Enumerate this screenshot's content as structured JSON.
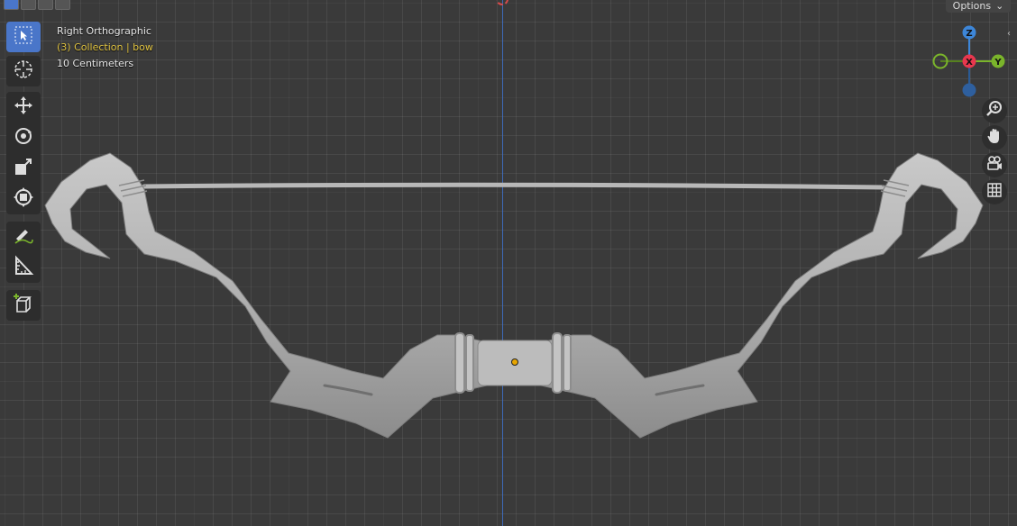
{
  "viewport": {
    "view_name": "Right Orthographic",
    "collection_label": "(3) Collection | bow",
    "scale_label": "10 Centimeters"
  },
  "header": {
    "options_label": "Options"
  },
  "toolbar": {
    "tools": [
      {
        "name": "select-box",
        "icon": "cursor-select-icon",
        "active": true
      },
      {
        "name": "cursor",
        "icon": "crosshair-cursor-icon"
      },
      {
        "name": "move",
        "icon": "move-arrows-icon"
      },
      {
        "name": "rotate",
        "icon": "rotate-icon"
      },
      {
        "name": "scale",
        "icon": "scale-icon"
      },
      {
        "name": "transform",
        "icon": "transform-icon"
      },
      {
        "name": "annotate",
        "icon": "annotate-pen-icon"
      },
      {
        "name": "measure",
        "icon": "measure-ruler-icon"
      },
      {
        "name": "add-cube",
        "icon": "add-cube-icon"
      }
    ]
  },
  "gizmo": {
    "x_label": "X",
    "y_label": "Y",
    "z_label": "Z",
    "x_color": "#e8374e",
    "y_color": "#7ab42b",
    "z_color": "#3d86d8"
  },
  "navigation": [
    "zoom-icon",
    "hand-pan-icon",
    "camera-icon",
    "grid-ortho-icon"
  ],
  "colors": {
    "background": "#3a3a3a",
    "accent": "#4a76c9",
    "collection_text": "#e0c341"
  }
}
